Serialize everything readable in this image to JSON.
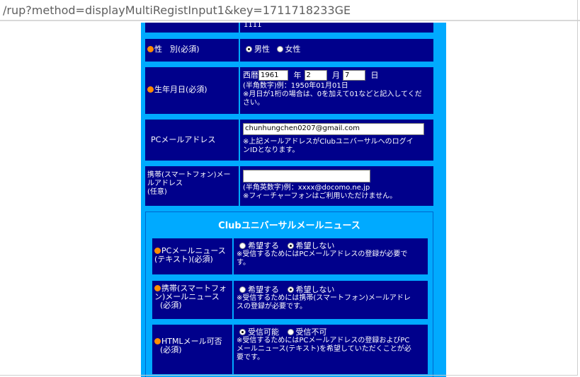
{
  "browser": {
    "url": "/rup?method=displayMultiRegistInput1&key=1711718233GE"
  },
  "form": {
    "top_partial_value": "1111",
    "gender": {
      "label": "性　別(必須)",
      "options": [
        "男性",
        "女性"
      ]
    },
    "birthdate": {
      "label": "生年月日(必須)",
      "era_label": "西暦",
      "year": "1961",
      "year_unit": "年",
      "month": "2",
      "month_unit": "月",
      "day": "7",
      "day_unit": "日",
      "note1": "(半角数字)例：1950年01月01日",
      "note2a": "※月日が1桁の場合は、0を加えて01などと記入してくだ",
      "note2b": "さい。"
    },
    "pc_mail": {
      "label": "PCメールアドレス",
      "value": "chunhungchen0207@gmail.com",
      "note_a": "※上記メールアドレスがClubユニバーサルへのログイ",
      "note_b": "ンIDとなります。"
    },
    "mobile_mail": {
      "label_a": "携帯(スマートフォン)メー",
      "label_b": "ルアドレス",
      "label_c": "(任意)",
      "value": "",
      "note1": "(半角英数字)例：xxxx@docomo.ne.jp",
      "note2": "※フィーチャーフォンはご利用いただけません。"
    }
  },
  "news": {
    "title": "Clubユニバーサルメールニュース",
    "pc_text": {
      "label_a": "PCメールニュース",
      "label_b": "(テキスト)(必須)",
      "opt_yes": "希望する",
      "opt_no": "希望しない",
      "note_a": "※受信するためにはPCメールアドレスの登録が必要で",
      "note_b": "す。"
    },
    "mobile": {
      "label_a": "携帯(スマートフォ",
      "label_b": "ン)メールニュース",
      "label_c": "(必須)",
      "opt_yes": "希望する",
      "opt_no": "希望しない",
      "note_a": "※受信するためには携帯(スマートフォン)メールアドレ",
      "note_b": "スの登録が必要です。"
    },
    "html": {
      "label_a": "HTMLメール可否",
      "label_b": "(必須)",
      "opt_yes": "受信可能",
      "opt_no": "受信不可",
      "note_a": "※受信するためにはPCメールアドレスの登録およびPC",
      "note_b": "メールニュース(テキスト)を希望していただくことが必",
      "note_c": "要です。"
    }
  },
  "colors": {
    "page_bg": "#00aaff",
    "cell_bg": "#00008b",
    "bullet": "#ff8c00",
    "text": "#ffffff"
  }
}
